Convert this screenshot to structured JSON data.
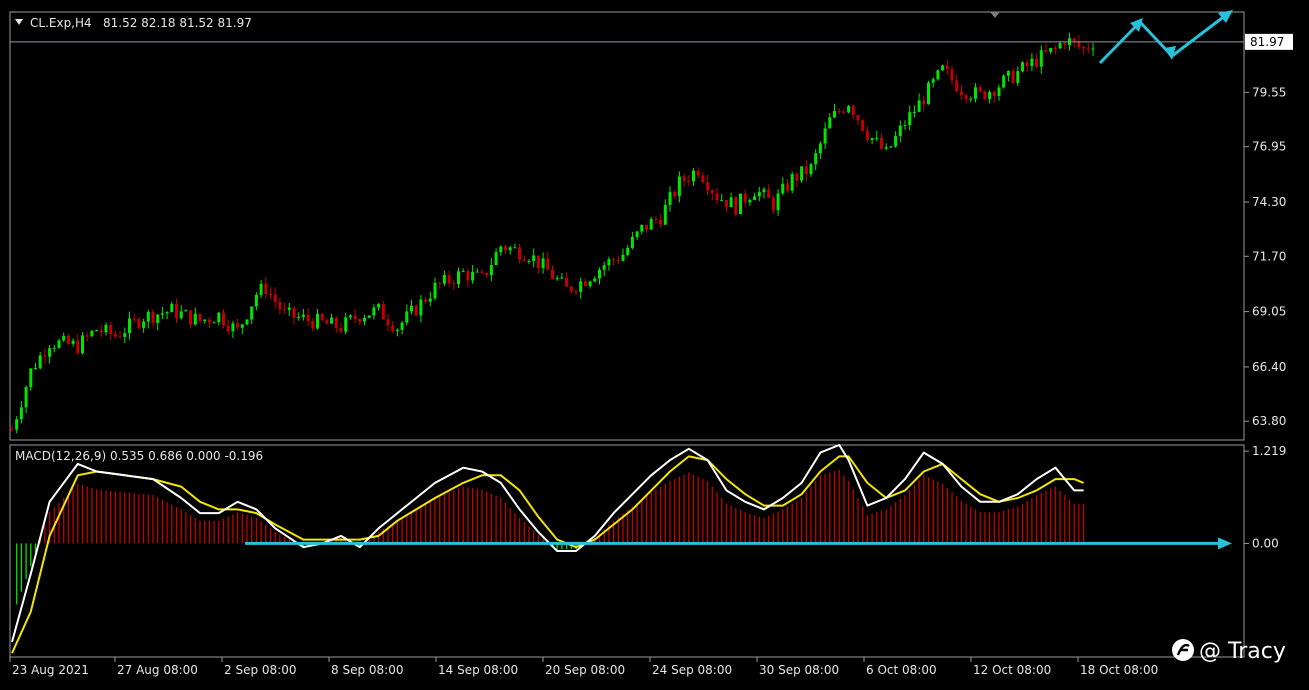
{
  "header": {
    "symbol_label": "CL.Exp,H4",
    "ohlc_text": "81.52 82.18 81.52 81.97"
  },
  "current_price_label": "81.97",
  "macd_label": "MACD(12,26,9) 0.535 0.686 0.000 -0.196",
  "watermark": "@ Tracy",
  "colors": {
    "background": "#000000",
    "bull": "#00e600",
    "bear": "#c40000",
    "macd_line": "#ffffff",
    "signal_line": "#f2e600",
    "arrow": "#27c2d8"
  },
  "chart_data": [
    {
      "type": "candlestick",
      "ylim": [
        62.9,
        83.4
      ],
      "yticks": [
        "63.80",
        "66.40",
        "69.05",
        "71.70",
        "74.30",
        "76.95",
        "79.55"
      ],
      "xticks": [
        "23 Aug 2021",
        "27 Aug 08:00",
        "2 Sep 08:00",
        "8 Sep 08:00",
        "14 Sep 08:00",
        "20 Sep 08:00",
        "24 Sep 08:00",
        "30 Sep 08:00",
        "6 Oct 08:00",
        "12 Oct 08:00",
        "18 Oct 08:00"
      ],
      "current_price": 81.97,
      "close_path": [
        [
          0,
          63.4
        ],
        [
          4,
          66.2
        ],
        [
          8,
          67.6
        ],
        [
          14,
          67.4
        ],
        [
          18,
          68.2
        ],
        [
          22,
          67.9
        ],
        [
          28,
          68.8
        ],
        [
          34,
          69.1
        ],
        [
          40,
          68.6
        ],
        [
          44,
          68.9
        ],
        [
          48,
          68.1
        ],
        [
          52,
          69.9
        ],
        [
          54,
          70.2
        ],
        [
          58,
          68.9
        ],
        [
          64,
          68.6
        ],
        [
          70,
          68.3
        ],
        [
          74,
          68.9
        ],
        [
          78,
          69.1
        ],
        [
          82,
          68.3
        ],
        [
          86,
          69.2
        ],
        [
          90,
          70.2
        ],
        [
          96,
          70.9
        ],
        [
          100,
          70.6
        ],
        [
          104,
          72.2
        ],
        [
          110,
          71.8
        ],
        [
          114,
          71.0
        ],
        [
          118,
          70.1
        ],
        [
          122,
          70.6
        ],
        [
          126,
          71.3
        ],
        [
          130,
          71.8
        ],
        [
          134,
          73.0
        ],
        [
          138,
          73.6
        ],
        [
          142,
          75.2
        ],
        [
          146,
          75.9
        ],
        [
          150,
          74.6
        ],
        [
          154,
          74.1
        ],
        [
          158,
          74.9
        ],
        [
          162,
          74.2
        ],
        [
          166,
          75.4
        ],
        [
          170,
          75.9
        ],
        [
          174,
          78.2
        ],
        [
          178,
          79.1
        ],
        [
          182,
          77.6
        ],
        [
          186,
          76.6
        ],
        [
          190,
          78.1
        ],
        [
          194,
          79.3
        ],
        [
          198,
          80.6
        ],
        [
          202,
          79.7
        ],
        [
          206,
          79.4
        ],
        [
          210,
          79.9
        ],
        [
          214,
          80.5
        ],
        [
          218,
          81.1
        ],
        [
          222,
          81.6
        ],
        [
          224,
          82.1
        ],
        [
          228,
          81.6
        ],
        [
          230,
          81.97
        ]
      ]
    },
    {
      "type": "macd",
      "ylim": [
        -1.5,
        1.3
      ],
      "yticks": [
        "1.219",
        "0.00"
      ],
      "series": [
        {
          "values": [
            [
              0,
              -1.3
            ],
            [
              4,
              -0.4
            ],
            [
              8,
              0.55
            ],
            [
              14,
              1.05
            ],
            [
              18,
              0.95
            ],
            [
              24,
              0.9
            ],
            [
              30,
              0.85
            ],
            [
              36,
              0.6
            ],
            [
              40,
              0.4
            ],
            [
              44,
              0.4
            ],
            [
              48,
              0.55
            ],
            [
              52,
              0.45
            ],
            [
              56,
              0.2
            ],
            [
              62,
              -0.05
            ],
            [
              66,
              0.0
            ],
            [
              70,
              0.1
            ],
            [
              74,
              -0.05
            ],
            [
              78,
              0.2
            ],
            [
              82,
              0.4
            ],
            [
              86,
              0.6
            ],
            [
              90,
              0.8
            ],
            [
              96,
              1.0
            ],
            [
              100,
              0.95
            ],
            [
              104,
              0.8
            ],
            [
              108,
              0.45
            ],
            [
              112,
              0.15
            ],
            [
              116,
              -0.1
            ],
            [
              120,
              -0.1
            ],
            [
              124,
              0.1
            ],
            [
              128,
              0.4
            ],
            [
              132,
              0.65
            ],
            [
              136,
              0.9
            ],
            [
              140,
              1.1
            ],
            [
              144,
              1.25
            ],
            [
              148,
              1.1
            ],
            [
              152,
              0.7
            ],
            [
              156,
              0.55
            ],
            [
              160,
              0.45
            ],
            [
              164,
              0.6
            ],
            [
              168,
              0.8
            ],
            [
              172,
              1.2
            ],
            [
              176,
              1.3
            ],
            [
              178,
              1.1
            ],
            [
              182,
              0.5
            ],
            [
              186,
              0.6
            ],
            [
              190,
              0.85
            ],
            [
              194,
              1.2
            ],
            [
              198,
              1.05
            ],
            [
              202,
              0.75
            ],
            [
              206,
              0.55
            ],
            [
              210,
              0.55
            ],
            [
              214,
              0.65
            ],
            [
              218,
              0.85
            ],
            [
              222,
              1.0
            ],
            [
              226,
              0.7
            ],
            [
              228,
              0.7
            ]
          ]
        },
        {
          "values": [
            [
              0,
              -1.45
            ],
            [
              4,
              -0.9
            ],
            [
              8,
              0.1
            ],
            [
              14,
              0.9
            ],
            [
              18,
              0.95
            ],
            [
              24,
              0.9
            ],
            [
              30,
              0.85
            ],
            [
              36,
              0.75
            ],
            [
              40,
              0.55
            ],
            [
              44,
              0.45
            ],
            [
              48,
              0.45
            ],
            [
              52,
              0.4
            ],
            [
              56,
              0.25
            ],
            [
              62,
              0.05
            ],
            [
              66,
              0.05
            ],
            [
              70,
              0.05
            ],
            [
              74,
              0.05
            ],
            [
              78,
              0.1
            ],
            [
              82,
              0.3
            ],
            [
              86,
              0.45
            ],
            [
              90,
              0.6
            ],
            [
              96,
              0.8
            ],
            [
              100,
              0.9
            ],
            [
              104,
              0.9
            ],
            [
              108,
              0.7
            ],
            [
              112,
              0.35
            ],
            [
              116,
              0.05
            ],
            [
              120,
              -0.05
            ],
            [
              124,
              0.05
            ],
            [
              128,
              0.25
            ],
            [
              132,
              0.45
            ],
            [
              136,
              0.7
            ],
            [
              140,
              0.95
            ],
            [
              144,
              1.15
            ],
            [
              148,
              1.1
            ],
            [
              152,
              0.85
            ],
            [
              156,
              0.65
            ],
            [
              160,
              0.5
            ],
            [
              164,
              0.5
            ],
            [
              168,
              0.65
            ],
            [
              172,
              0.95
            ],
            [
              176,
              1.15
            ],
            [
              178,
              1.15
            ],
            [
              182,
              0.8
            ],
            [
              186,
              0.6
            ],
            [
              190,
              0.7
            ],
            [
              194,
              0.95
            ],
            [
              198,
              1.05
            ],
            [
              202,
              0.85
            ],
            [
              206,
              0.65
            ],
            [
              210,
              0.55
            ],
            [
              214,
              0.6
            ],
            [
              218,
              0.7
            ],
            [
              222,
              0.85
            ],
            [
              226,
              0.85
            ],
            [
              228,
              0.8
            ]
          ]
        }
      ]
    }
  ]
}
